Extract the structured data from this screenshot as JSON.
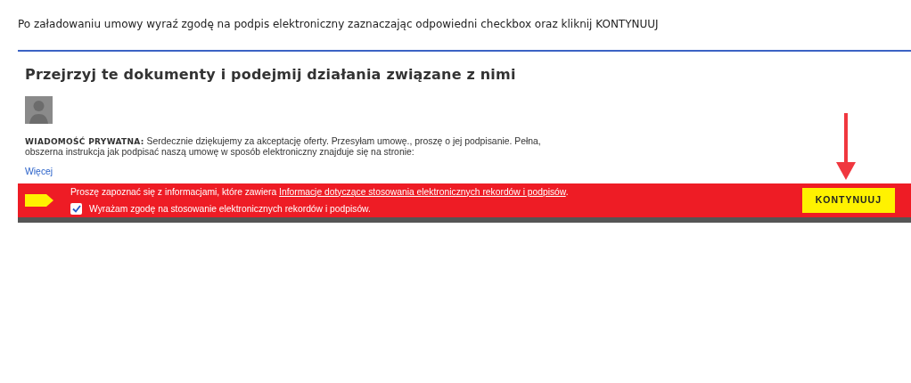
{
  "instruction": "Po załadowaniu umowy wyraź zgodę na podpis elektroniczny zaznaczając odpowiedni checkbox oraz kliknij KONTYNUUJ",
  "heading": "Przejrzyj te dokumenty i podejmij działania związane z nimi",
  "message": {
    "label": "WIADOMOŚĆ PRYWATNA:",
    "text": "Serdecznie dziękujemy za akceptację oferty.  Przesyłam umowę., proszę o jej podpisanie.  Pełna, obszerna instrukcja jak podpisać naszą umowę w sposób elektroniczny znajduje się na stronie:",
    "more": "Więcej"
  },
  "consent_bar": {
    "intro": "Proszę zapoznać się z informacjami, które zawiera ",
    "link": "Informacje dotyczące stosowania elektronicznych rekordów i podpisów",
    "after": ".",
    "checkbox": {
      "label": "Wyrażam zgodę na stosowanie elektronicznych rekordów i podpisów.",
      "checked": true
    },
    "button": "KONTYNUUJ"
  }
}
